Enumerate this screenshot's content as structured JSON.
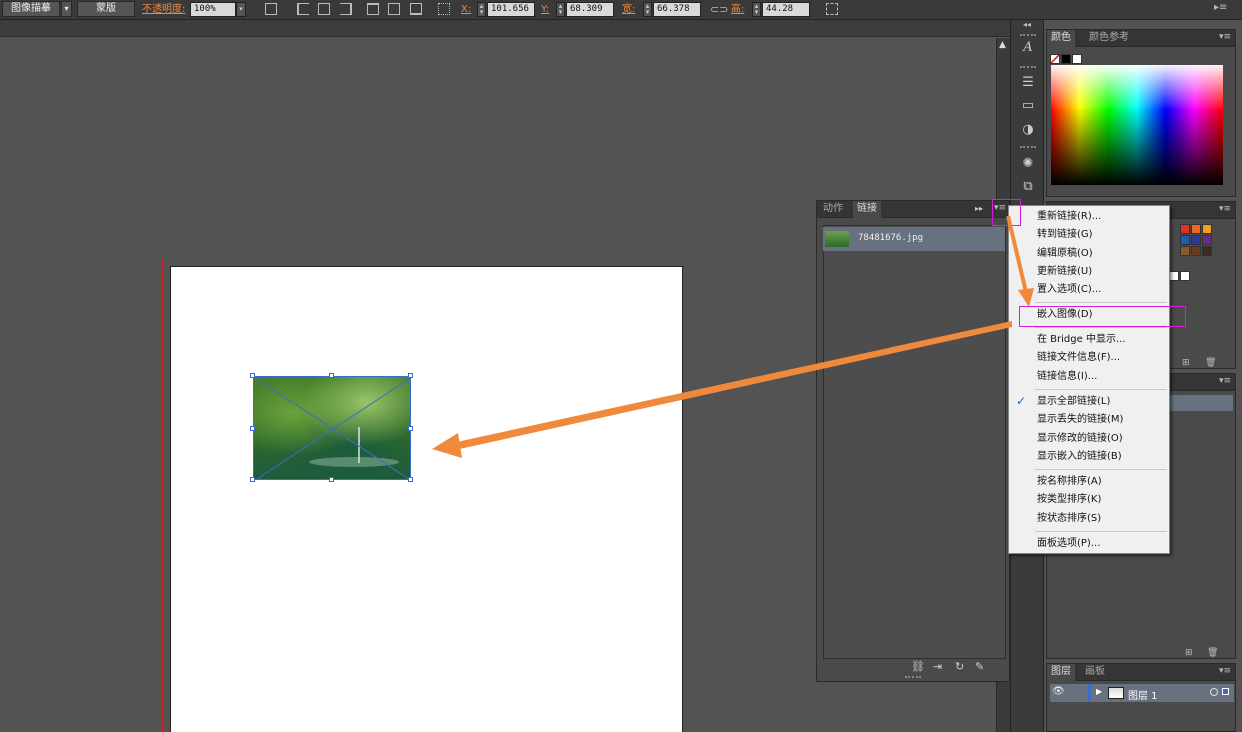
{
  "control_bar": {
    "trace_button": "图像描摹",
    "mask_button": "蒙版",
    "opacity_label": "不透明度:",
    "opacity_value": "100%",
    "x_label": "X:",
    "x_value": "101.656",
    "y_label": "Y:",
    "y_value": "68.309 mm",
    "w_label": "宽:",
    "w_value": "66.378 mm",
    "h_label": "高:",
    "h_value": "44.28 mm"
  },
  "color_panel": {
    "tab_color": "颜色",
    "tab_guide": "颜色参考"
  },
  "links_panel": {
    "tab_actions": "动作",
    "tab_links": "链接",
    "link_items": [
      {
        "name": "78481676.jpg"
      }
    ]
  },
  "context_menu": {
    "items": [
      "重新链接(R)...",
      "转到链接(G)",
      "编辑原稿(O)",
      "更新链接(U)",
      "置入选项(C)...",
      "嵌入图像(D)",
      "在 Bridge 中显示...",
      "链接文件信息(F)...",
      "链接信息(I)...",
      "显示全部链接(L)",
      "显示丢失的链接(M)",
      "显示修改的链接(O)",
      "显示嵌入的链接(B)",
      "按名称排序(A)",
      "按类型排序(K)",
      "按状态排序(S)",
      "面板选项(P)..."
    ],
    "checked_item": "显示全部链接(L)",
    "highlighted_item": "嵌入图像(D)"
  },
  "layers_panel": {
    "tab_layers": "图层",
    "tab_artboards": "画板",
    "layer_name": "图层 1"
  },
  "colors": {
    "annotation_arrow": "#f0893c",
    "annotation_box": "#d11fd9",
    "bleed_border": "#c8231f",
    "selection": "#3a6cc8"
  }
}
